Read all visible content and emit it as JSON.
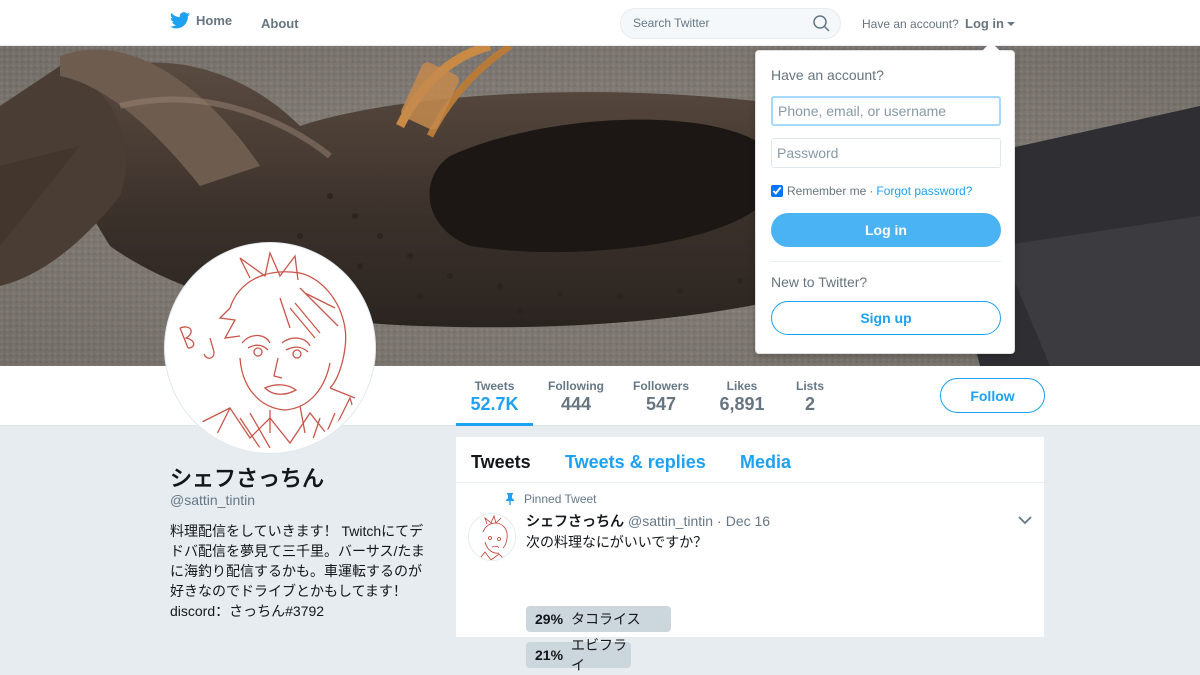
{
  "topbar": {
    "home_label": "Home",
    "about_label": "About",
    "search_placeholder": "Search Twitter",
    "have_account": "Have an account?",
    "login_label": "Log in"
  },
  "profile": {
    "name": "シェフさっちん",
    "handle": "@sattin_tintin",
    "bio_lines": [
      "料理配信をしていきます！ Twitchにてデ",
      "ドバ配信を夢見て三千里。バーサス/たま",
      "に海釣り配信するかも。車運転するのが",
      "好きなのでドライブとかもしてます！",
      "discord：さっちん#3792"
    ],
    "stats": [
      {
        "label": "Tweets",
        "value": "52.7K"
      },
      {
        "label": "Following",
        "value": "444"
      },
      {
        "label": "Followers",
        "value": "547"
      },
      {
        "label": "Likes",
        "value": "6,891"
      },
      {
        "label": "Lists",
        "value": "2"
      }
    ],
    "follow_label": "Follow"
  },
  "timeline": {
    "tabs": [
      "Tweets",
      "Tweets & replies",
      "Media"
    ],
    "pinned_label": "Pinned Tweet",
    "tweet": {
      "name": "シェフさっちん",
      "handle": "@sattin_tintin",
      "separator": "·",
      "date": "Dec 16",
      "text": "次の料理なにがいいですか？",
      "poll": [
        {
          "pct": "29%",
          "label": "タコライス",
          "fraction": 0.29
        },
        {
          "pct": "21%",
          "label": "エビフライ",
          "fraction": 0.21
        }
      ]
    }
  },
  "login_dropdown": {
    "title": "Have an account?",
    "username_placeholder": "Phone, email, or username",
    "password_placeholder": "Password",
    "remember_label": "Remember me",
    "separator": "·",
    "forgot_label": "Forgot password?",
    "login_button": "Log in",
    "new_label": "New to Twitter?",
    "signup_button": "Sign up"
  },
  "colors": {
    "accent": "#1da1f2",
    "login_button": "#4ab3f4",
    "page_bg": "#e6ecf0"
  }
}
